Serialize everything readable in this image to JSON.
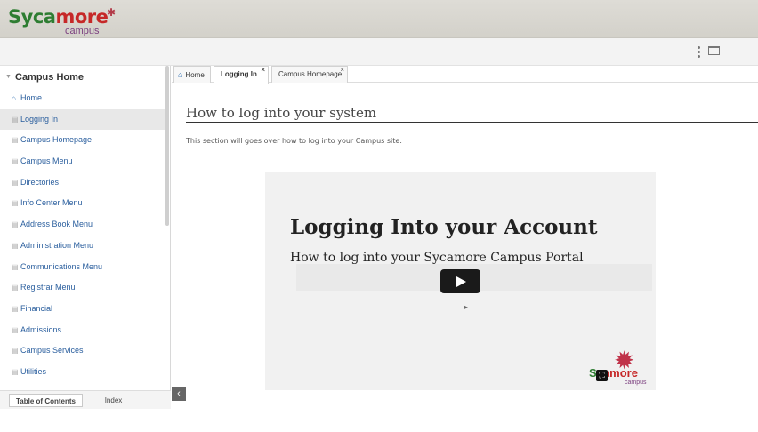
{
  "header": {
    "logo_main_a": "Syca",
    "logo_main_b": "more",
    "logo_sub": "campus"
  },
  "sidebar": {
    "title": "Campus Home",
    "items": [
      {
        "label": "Home"
      },
      {
        "label": "Logging In"
      },
      {
        "label": "Campus Homepage"
      },
      {
        "label": "Campus Menu"
      },
      {
        "label": "Directories"
      },
      {
        "label": "Info Center Menu"
      },
      {
        "label": "Address Book Menu"
      },
      {
        "label": "Administration Menu"
      },
      {
        "label": "Communications Menu"
      },
      {
        "label": "Registrar Menu"
      },
      {
        "label": "Financial"
      },
      {
        "label": "Admissions"
      },
      {
        "label": "Campus Services"
      },
      {
        "label": "Utilities"
      }
    ],
    "tabs": {
      "toc": "Table of Contents",
      "index": "Index"
    }
  },
  "tabs": [
    {
      "label": "Home"
    },
    {
      "label": "Logging In"
    },
    {
      "label": "Campus Homepage"
    }
  ],
  "content": {
    "title": "How to log into your system",
    "description": "This section will goes over how to log into your Campus site."
  },
  "video": {
    "title": "Logging Into your Account",
    "subtitle": "How to log into your Sycamore Campus Portal",
    "logo_a": "Sy",
    "logo_b": "amore",
    "logo_sub": "campus"
  },
  "icons": {
    "kebab": "kebab-menu-icon",
    "window": "window-icon",
    "home": "home-icon",
    "page": "page-icon",
    "close": "close-icon",
    "collapse": "chevron-left-icon",
    "play": "play-icon"
  },
  "colors": {
    "link": "#2b5f9e",
    "brand_green": "#2e7d32",
    "brand_red": "#c62828",
    "brand_purple": "#7b3f7f"
  }
}
